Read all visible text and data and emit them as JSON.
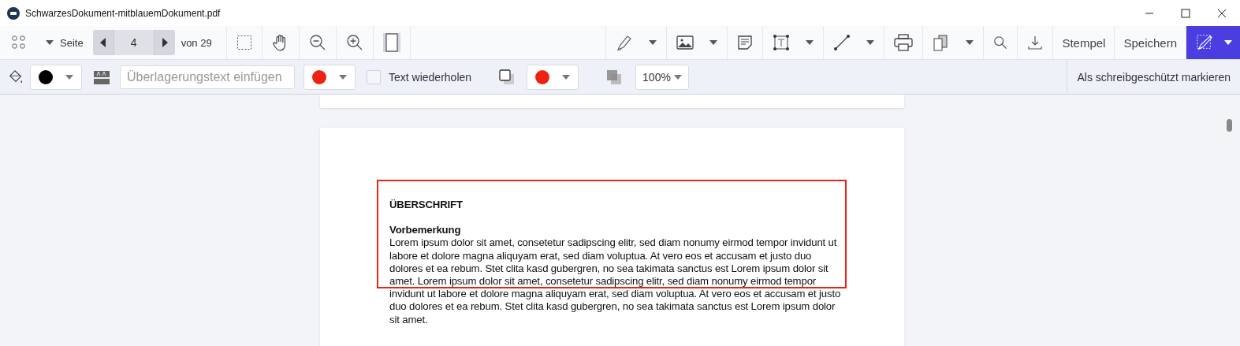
{
  "window": {
    "title": "SchwarzesDokument-mitblauemDokument.pdf"
  },
  "toolbar": {
    "page_label": "Seite",
    "page_value": "4",
    "page_total": "von 29",
    "stamp_button": "Stempel",
    "save_button": "Speichern",
    "redact_tool_selected": true
  },
  "properties": {
    "overlay_text_placeholder": "Überlagerungstext einfügen",
    "color_pickers": [
      {
        "color": "#000000"
      },
      {
        "color": "#ee2211"
      },
      {
        "color": "#ee2211"
      }
    ],
    "repeat_text": {
      "label": "Text wiederholen",
      "checked": false
    },
    "opacity": "100%",
    "readonly_button": "Als schreibgeschützt markieren"
  },
  "document": {
    "heading": "ÜBERSCHRIFT",
    "subheading": "Vorbemerkung",
    "lines": [
      "Lorem ipsum dolor sit amet, consetetur sadipscing elitr, sed diam nonumy eirmod tempor invidunt ut",
      "labore et dolore magna aliquyam erat, sed diam voluptua. At vero eos et accusam et justo duo",
      "dolores et ea rebum. Stet clita kasd gubergren, no sea takimata sanctus est Lorem ipsum dolor sit",
      "amet. Lorem ipsum dolor sit amet, consetetur sadipscing elitr, sed diam nonumy eirmod tempor",
      "invidunt ut labore et dolore magna aliquyam erat, sed diam voluptua. At vero eos et accusam et justo",
      "duo dolores et ea rebum. Stet clita kasd gubergren, no sea takimata sanctus est Lorem ipsum dolor",
      "sit amet."
    ]
  }
}
